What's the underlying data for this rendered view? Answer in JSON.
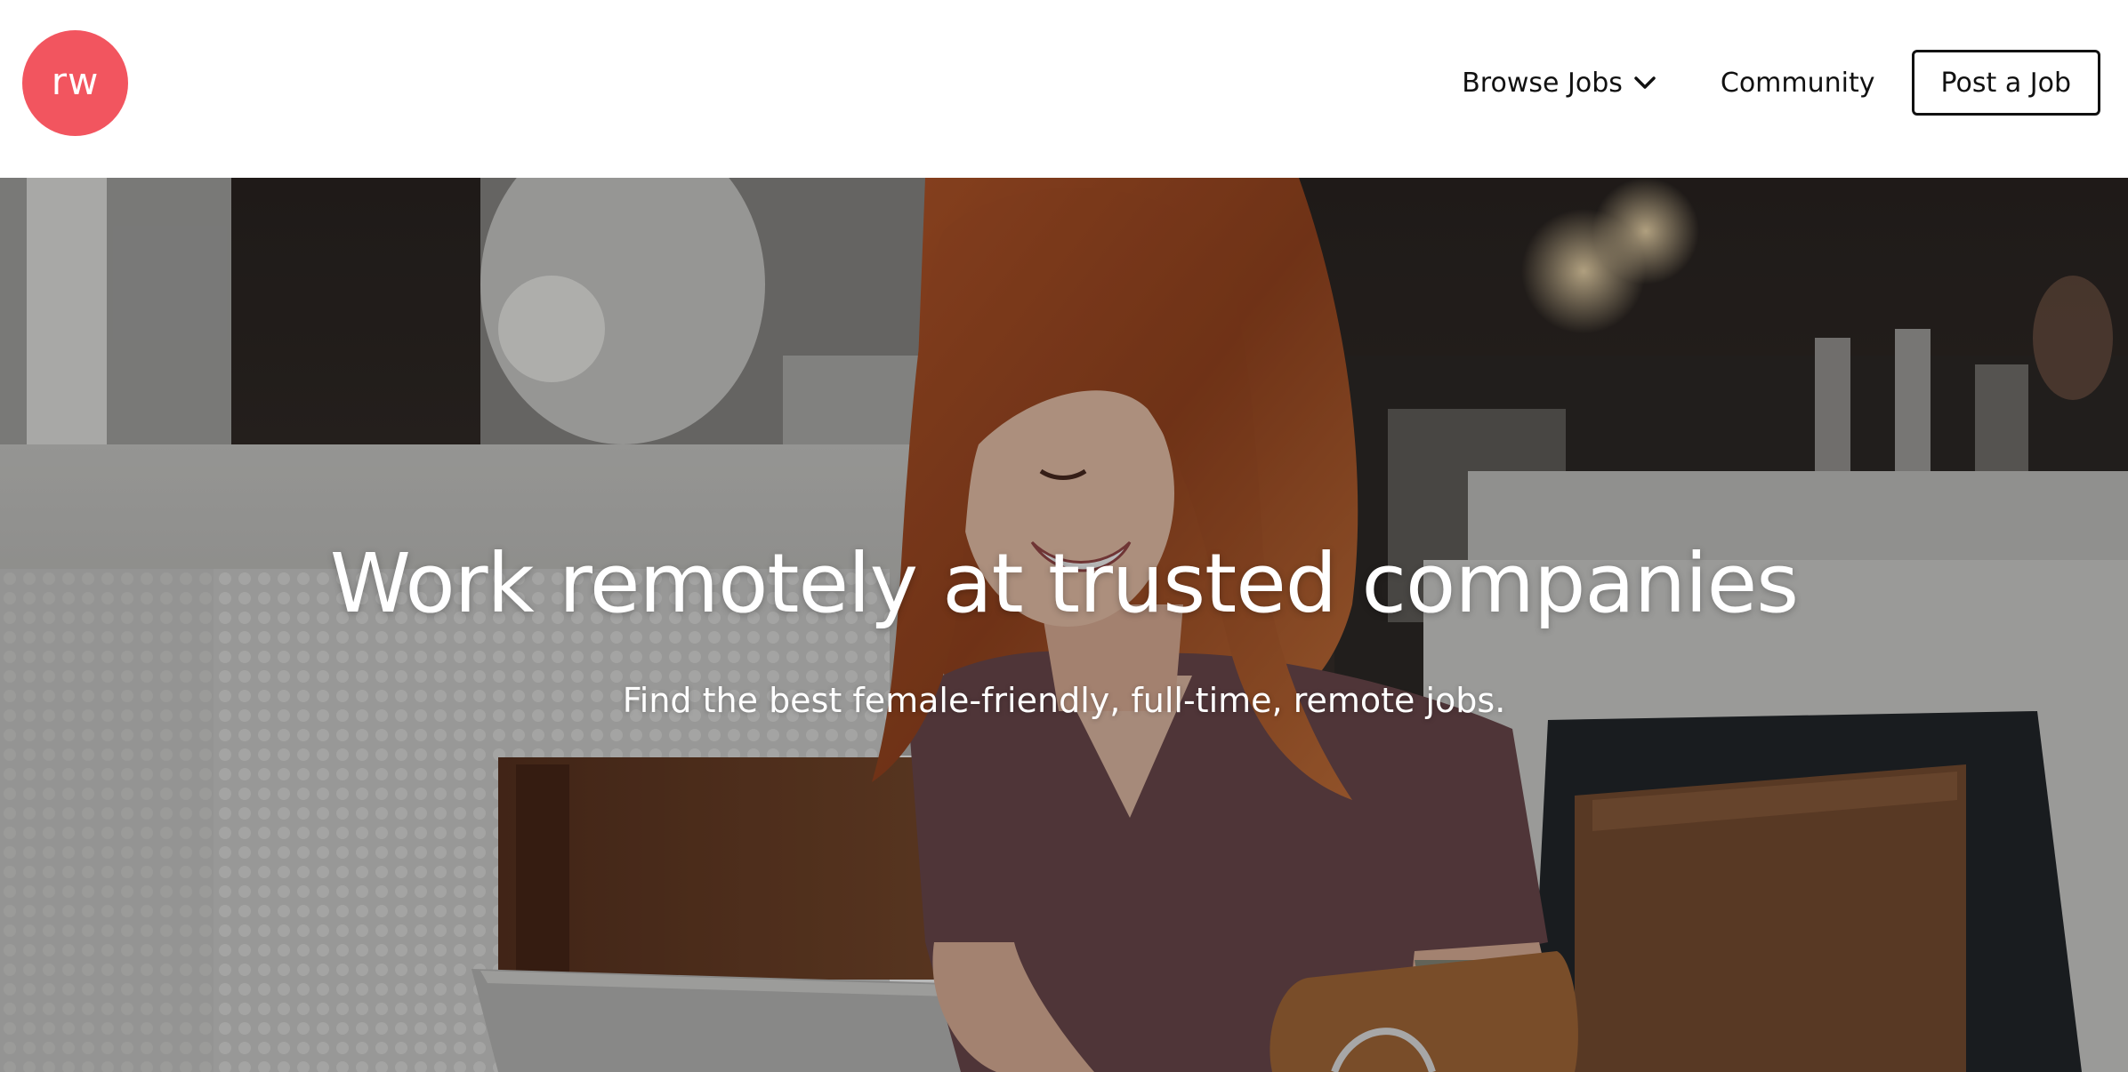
{
  "header": {
    "logo_text": "rw",
    "logo_color": "#f2555f",
    "nav": {
      "browse_jobs": "Browse Jobs",
      "browse_jobs_icon": "chevron-down-icon",
      "community": "Community",
      "post_job": "Post a Job"
    }
  },
  "hero": {
    "title": "Work remotely at trusted companies",
    "subtitle": "Find the best female-friendly, full-time, remote jobs.",
    "image_description": "woman-with-laptop-in-cafe"
  }
}
